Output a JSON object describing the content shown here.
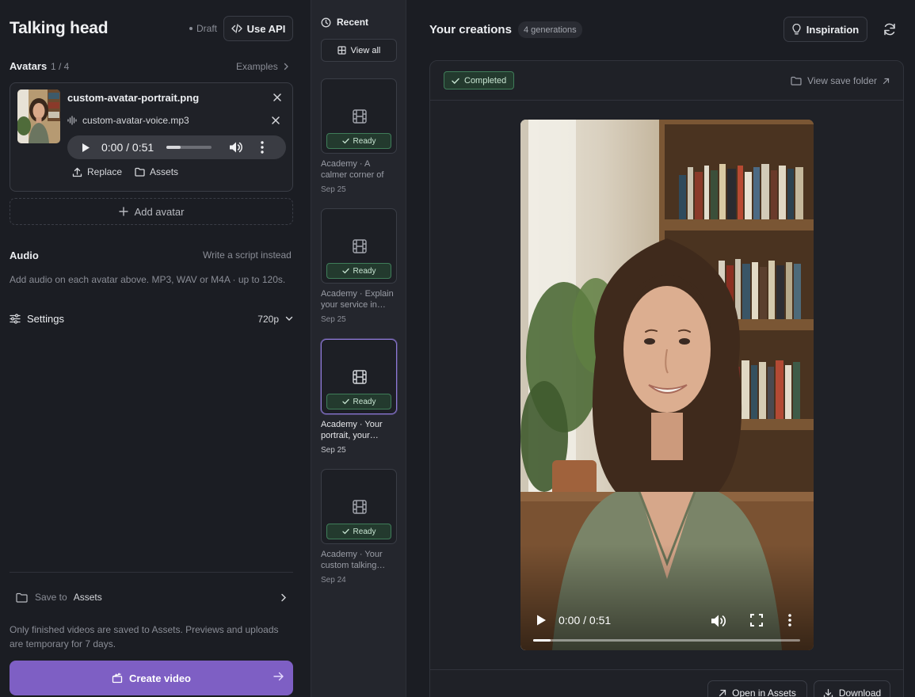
{
  "header": {
    "title": "Talking head",
    "status": "Draft",
    "api_label": "Use API"
  },
  "avatars": {
    "label": "Avatars",
    "count": "1 / 4",
    "examples_label": "Examples",
    "item": {
      "image_file": "custom-avatar-portrait.png",
      "voice_file": "custom-avatar-voice.mp3",
      "player_time": "0:00 / 0:51",
      "replace_label": "Replace",
      "assets_label": "Assets"
    },
    "add_label": "Add avatar"
  },
  "audio": {
    "label": "Audio",
    "alt_label": "Write a script instead",
    "help": "Add audio on each avatar above. MP3, WAV or M4A · up to 120s."
  },
  "settings": {
    "label": "Settings",
    "resolution": "720p"
  },
  "save": {
    "label": "Save to",
    "destination": "Assets",
    "note": "Only finished videos are saved to Assets. Previews and uploads are temporary for 7 days."
  },
  "create_label": "Create video",
  "recent": {
    "title": "Recent",
    "view_all": "View all",
    "items": [
      {
        "status": "Ready",
        "caption": "Academy · A calmer corner of your day",
        "date": "Sep 25"
      },
      {
        "status": "Ready",
        "caption": "Academy · Explain your service in…",
        "date": "Sep 25"
      },
      {
        "status": "Ready",
        "caption": "Academy · Your portrait, your…",
        "date": "Sep 25"
      },
      {
        "status": "Ready",
        "caption": "Academy · Your custom talking…",
        "date": "Sep 24"
      }
    ]
  },
  "creations": {
    "title": "Your creations",
    "count": "4 generations",
    "inspiration_label": "Inspiration",
    "status": "Completed",
    "view_folder": "View save folder",
    "video_time": "0:00 / 0:51",
    "open_assets": "Open in Assets",
    "download": "Download"
  },
  "colors": {
    "accent": "#7e5fc4",
    "ready_green": "#3f7d59",
    "background": "#1b1d23"
  }
}
